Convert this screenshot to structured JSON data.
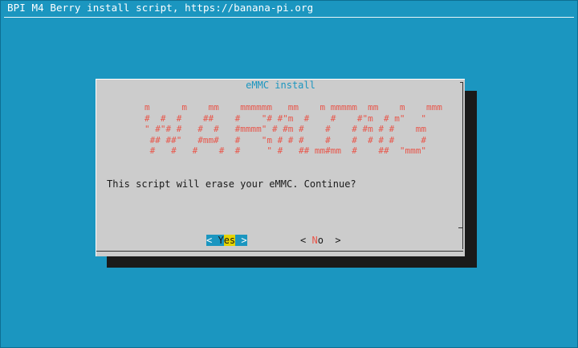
{
  "backtitle": "BPI M4 Berry install script, https://banana-pi.org",
  "dialog": {
    "title": "eMMC install",
    "ascii_art": [
      "m      m    mm    mmmmmm   mm    m mmmmm  mm    m    mmm",
      "#  #  #    ##    #    \"# #\"m  #    #    #\"m  # m\"   \"",
      "\" #\"# #   #  #   #mmmm\" # #m #    #    # #m # #    mm",
      " ## ##\"   #mm#   #    \"m # # #    #    #  # # #     #",
      " #   #   #    #  #     \" #   ## mm#mm  #    ##  \"mmm\""
    ],
    "message": "This script will erase your eMMC. Continue?",
    "buttons": {
      "yes": {
        "open": "<",
        "hotkey": "Y",
        "rest": "es",
        "close": ">"
      },
      "no": {
        "open": "<",
        "hotkey": "N",
        "rest": "o",
        "close": ">"
      }
    }
  },
  "colors": {
    "background": "#1b96c0",
    "dialog": "#cccccc",
    "ascii": "#e8564a",
    "title": "#1b96c0",
    "yes_highlight": "#e5d400"
  }
}
